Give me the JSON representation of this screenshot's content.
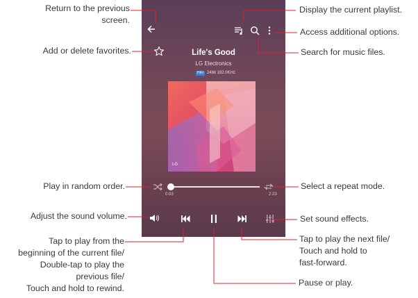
{
  "player": {
    "song_title": "Life's Good",
    "artist": "LG Electronics",
    "quality_badge": "HiFi",
    "quality_text": "24bit 192.0KHz",
    "art_logo": "LG",
    "current_time": "0:03",
    "total_time": "2:23",
    "progress": 0.03
  },
  "icons": {
    "back": "back-arrow-icon",
    "playlist": "playlist-icon",
    "search": "search-icon",
    "more": "more-options-icon",
    "favorite": "star-icon",
    "shuffle": "shuffle-icon",
    "repeat": "repeat-icon",
    "volume": "volume-icon",
    "previous": "previous-track-icon",
    "pause": "pause-icon",
    "next": "next-track-icon",
    "effects": "sound-effects-icon"
  },
  "annotations": {
    "return_1": "Return to the previous",
    "return_2": "screen.",
    "favorites": "Add or delete favorites.",
    "random": "Play in random order.",
    "volume": "Adjust the sound volume.",
    "prev_1": "Tap to play from the",
    "prev_2": "beginning of the current file/",
    "prev_3": "Double-tap to play the",
    "prev_4": "previous file/",
    "prev_5": "Touch and hold to rewind.",
    "playlist": "Display the current playlist.",
    "options": "Access additional options.",
    "search": "Search for music files.",
    "repeat": "Select a repeat mode.",
    "effects": "Set sound effects.",
    "next_1": "Tap to play the next file/",
    "next_2": "Touch and hold to",
    "next_3": "fast-forward.",
    "pause": "Pause or play."
  },
  "colors": {
    "leader_line": "#e0202a",
    "background_top": "#5a3e58",
    "background_bottom": "#5a3a4a"
  }
}
